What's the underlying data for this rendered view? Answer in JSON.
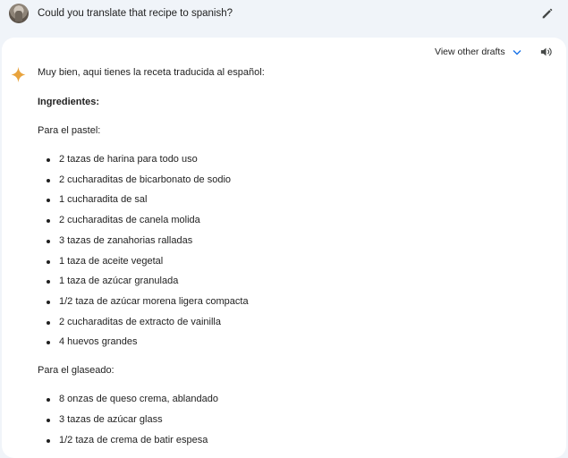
{
  "user": {
    "prompt": "Could you translate that recipe to spanish?",
    "avatar_icon": "user-avatar",
    "edit_icon": "pencil-icon"
  },
  "response": {
    "drafts_label": "View other drafts",
    "intro": "Muy bien, aqui tienes la receta traducida al español:",
    "heading": "Ingredientes:",
    "cake_heading": "Para el pastel:",
    "cake_items": [
      "2 tazas de harina para todo uso",
      "2 cucharaditas de bicarbonato de sodio",
      "1 cucharadita de sal",
      "2 cucharaditas de canela molida",
      "3 tazas de zanahorias ralladas",
      "1 taza de aceite vegetal",
      "1 taza de azúcar granulada",
      "1/2 taza de azúcar morena ligera compacta",
      "2 cucharaditas de extracto de vainilla",
      "4 huevos grandes"
    ],
    "frosting_heading": "Para el glaseado:",
    "frosting_items": [
      "8 onzas de queso crema, ablandado",
      "3 tazas de azúcar glass",
      "1/2 taza de crema de batir espesa"
    ]
  },
  "colors": {
    "page_background": "#f0f4f9",
    "card_background": "#ffffff",
    "accent_blue": "#1a73e8",
    "spark_orange": "#e8a33d"
  }
}
